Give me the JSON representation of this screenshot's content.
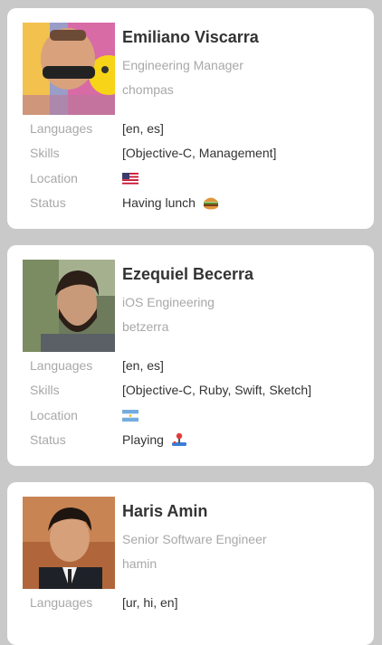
{
  "people": [
    {
      "name": "Emiliano Viscarra",
      "role": "Engineering Manager",
      "handle": "chompas",
      "labels": {
        "languages": "Languages",
        "skills": "Skills",
        "location": "Location",
        "status": "Status"
      },
      "languages": "[en, es]",
      "skills": "[Objective-C, Management]",
      "location_flag": "us-flag-icon",
      "status": "Having lunch",
      "status_icon": "burger-icon"
    },
    {
      "name": "Ezequiel Becerra",
      "role": "iOS Engineering",
      "handle": "betzerra",
      "labels": {
        "languages": "Languages",
        "skills": "Skills",
        "location": "Location",
        "status": "Status"
      },
      "languages": "[en, es]",
      "skills": "[Objective-C, Ruby, Swift, Sketch]",
      "location_flag": "argentina-flag-icon",
      "status": "Playing",
      "status_icon": "joystick-icon"
    },
    {
      "name": "Haris Amin",
      "role": "Senior Software Engineer",
      "handle": "hamin",
      "labels": {
        "languages": "Languages"
      },
      "languages": "[ur, hi, en]"
    }
  ],
  "colors": {
    "background": "#c9c9c9",
    "card": "#ffffff",
    "primary_text": "#333333",
    "secondary_text": "#a8a8a8"
  }
}
